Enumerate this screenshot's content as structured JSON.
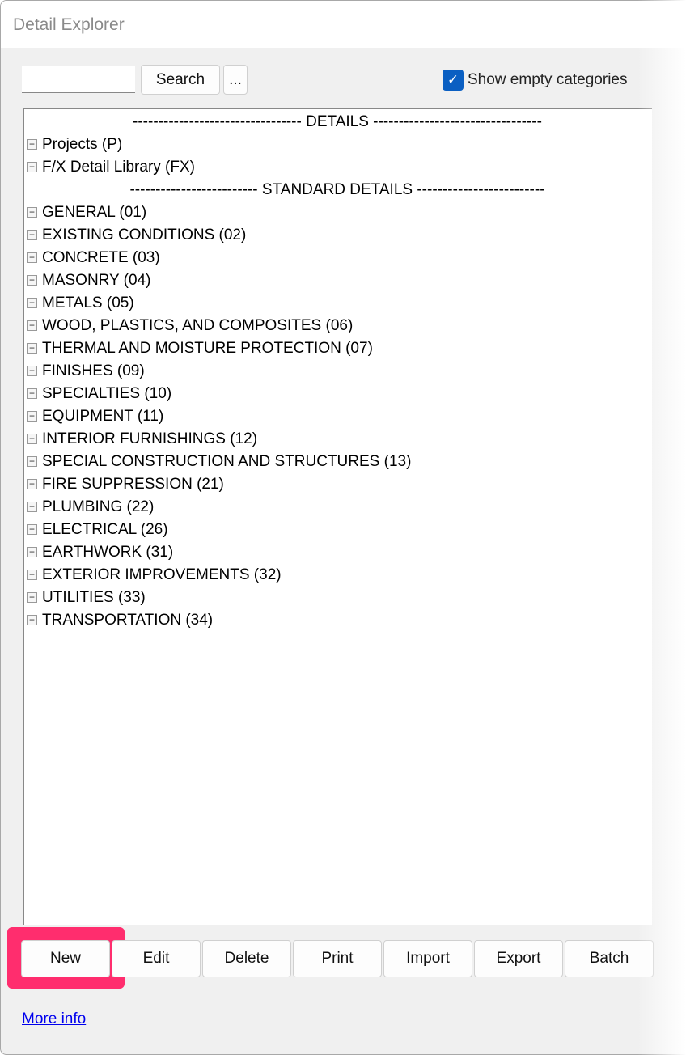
{
  "window": {
    "title": "Detail Explorer"
  },
  "toolbar": {
    "search_value": "",
    "search_label": "Search",
    "more_label": "...",
    "show_empty_label": "Show empty categories",
    "show_empty_checked": true
  },
  "tree": {
    "details_header": "--------------------------------- DETAILS ---------------------------------",
    "details_items": [
      "Projects (P)",
      "F/X Detail Library (FX)"
    ],
    "standard_header": "------------------------- STANDARD DETAILS -------------------------",
    "standard_items": [
      "GENERAL (01)",
      "EXISTING CONDITIONS (02)",
      "CONCRETE (03)",
      "MASONRY (04)",
      "METALS (05)",
      "WOOD, PLASTICS, AND COMPOSITES (06)",
      "THERMAL AND MOISTURE PROTECTION (07)",
      "FINISHES (09)",
      "SPECIALTIES (10)",
      "EQUIPMENT (11)",
      "INTERIOR FURNISHINGS (12)",
      "SPECIAL CONSTRUCTION AND STRUCTURES (13)",
      "FIRE SUPPRESSION (21)",
      "PLUMBING (22)",
      "ELECTRICAL (26)",
      "EARTHWORK (31)",
      "EXTERIOR IMPROVEMENTS (32)",
      "UTILITIES (33)",
      "TRANSPORTATION (34)"
    ]
  },
  "actions": [
    "New",
    "Edit",
    "Delete",
    "Print",
    "Import",
    "Export",
    "Batch"
  ],
  "highlight_color": "#ff2d6e",
  "footer": {
    "more_info": "More info"
  }
}
